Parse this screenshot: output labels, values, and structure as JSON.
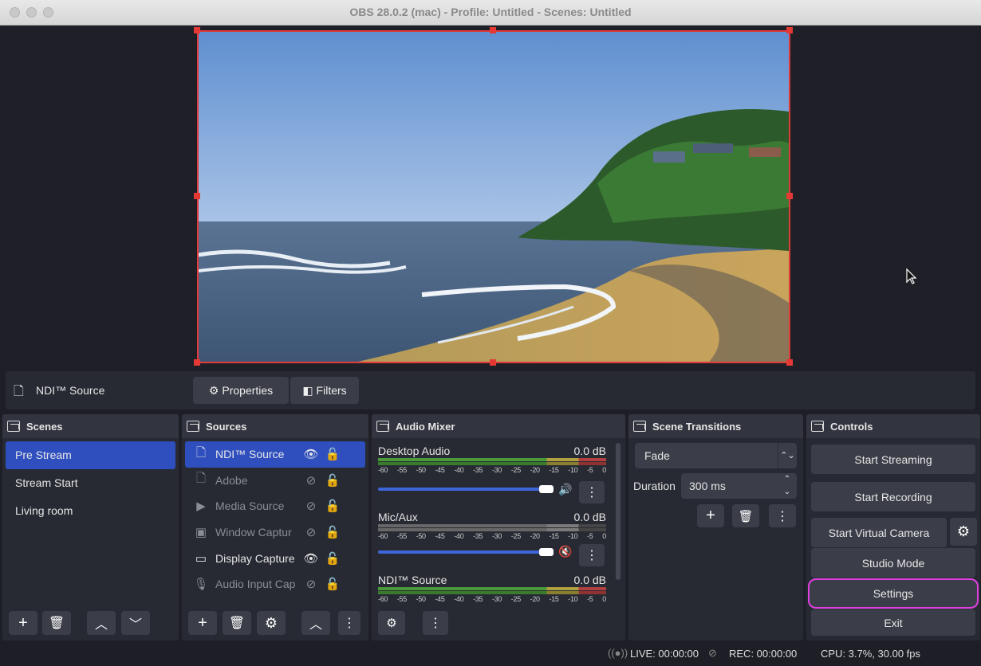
{
  "window": {
    "title": "OBS 28.0.2 (mac) - Profile: Untitled - Scenes: Untitled"
  },
  "source_toolbar": {
    "selected_source": "NDI™ Source",
    "properties_label": "Properties",
    "filters_label": "Filters"
  },
  "scenes": {
    "title": "Scenes",
    "items": [
      {
        "label": "Pre Stream"
      },
      {
        "label": "Stream Start"
      },
      {
        "label": "Living room"
      }
    ]
  },
  "sources": {
    "title": "Sources",
    "items": [
      {
        "label": "NDI™ Source",
        "visible": true
      },
      {
        "label": "Adobe",
        "visible": false
      },
      {
        "label": "Media Source",
        "visible": false
      },
      {
        "label": "Window Captur",
        "visible": false
      },
      {
        "label": "Display Capture",
        "visible": true
      },
      {
        "label": "Audio Input Cap",
        "visible": false
      }
    ]
  },
  "audio_mixer": {
    "title": "Audio Mixer",
    "ticks": [
      "-60",
      "-55",
      "-50",
      "-45",
      "-40",
      "-35",
      "-30",
      "-25",
      "-20",
      "-15",
      "-10",
      "-5",
      "0"
    ],
    "channels": [
      {
        "name": "Desktop Audio",
        "level": "0.0 dB",
        "muted": false
      },
      {
        "name": "Mic/Aux",
        "level": "0.0 dB",
        "muted": true
      },
      {
        "name": "NDI™ Source",
        "level": "0.0 dB",
        "muted": false
      }
    ]
  },
  "transitions": {
    "title": "Scene Transitions",
    "selected": "Fade",
    "duration_label": "Duration",
    "duration_value": "300 ms"
  },
  "controls": {
    "title": "Controls",
    "start_streaming": "Start Streaming",
    "start_recording": "Start Recording",
    "start_virtual_camera": "Start Virtual Camera",
    "studio_mode": "Studio Mode",
    "settings": "Settings",
    "exit": "Exit"
  },
  "status": {
    "live": "LIVE: 00:00:00",
    "rec": "REC: 00:00:00",
    "cpu": "CPU: 3.7%, 30.00 fps"
  },
  "colors": {
    "selection": "#2f4fbf",
    "accent_highlight": "#e040e0",
    "bounding_box": "#e03b3b"
  }
}
